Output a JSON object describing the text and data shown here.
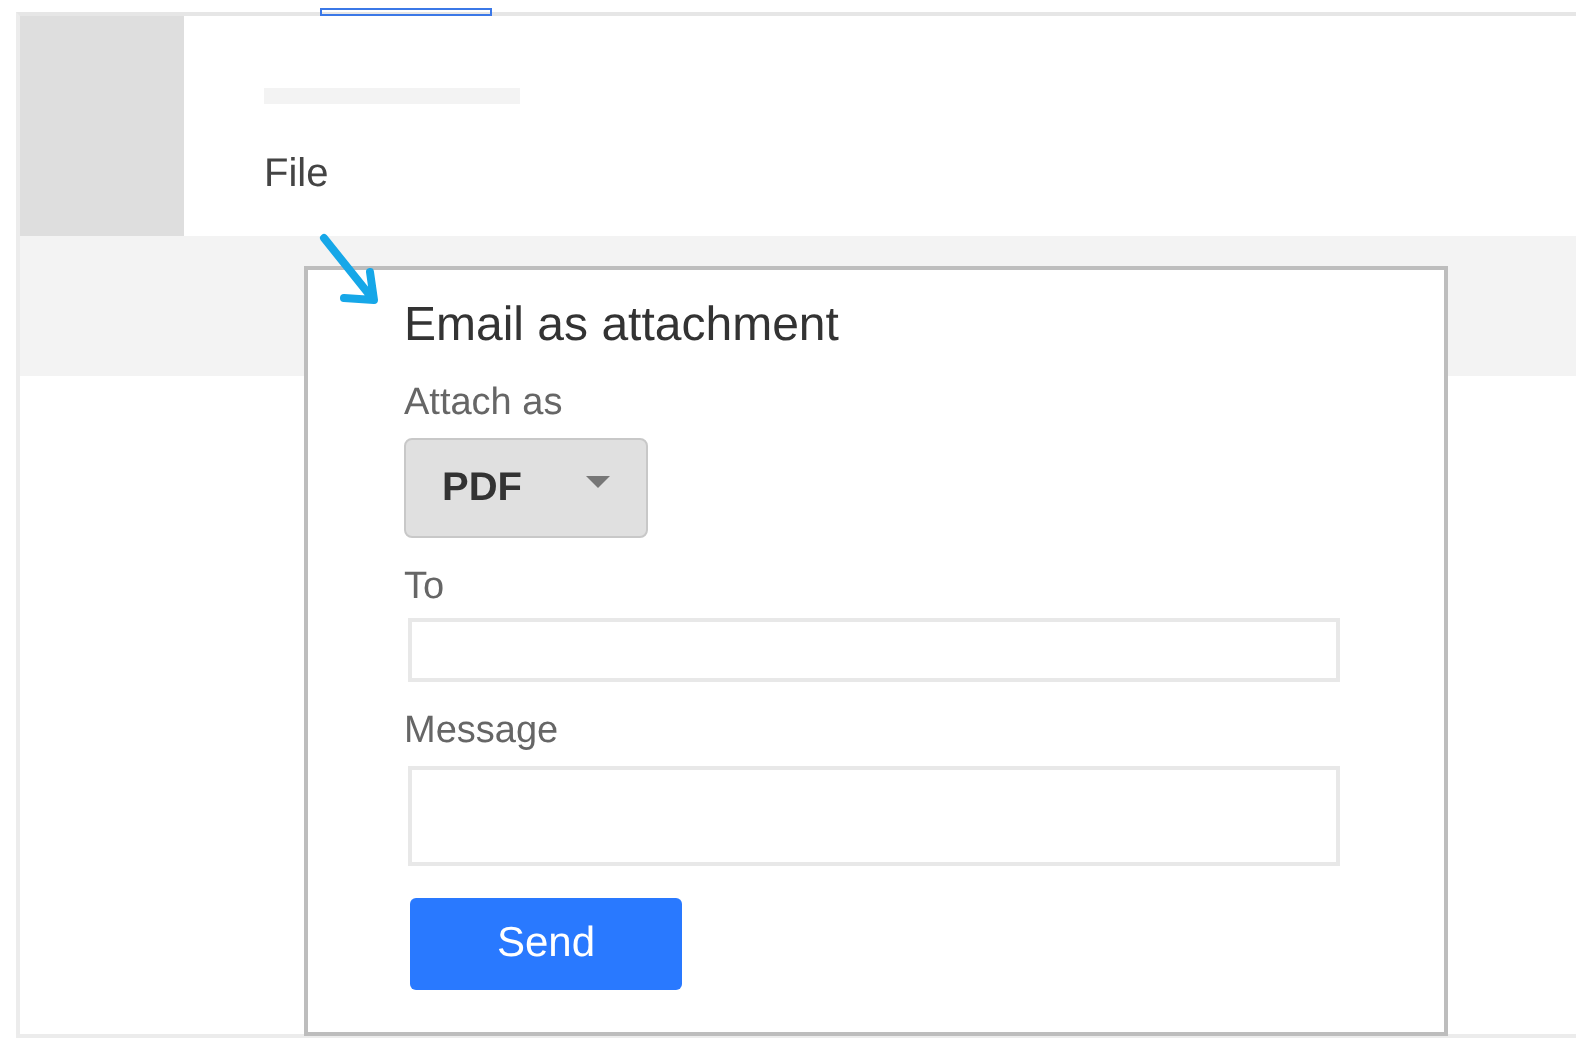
{
  "page": {
    "file_label": "File"
  },
  "dialog": {
    "title": "Email as attachment",
    "attach_label": "Attach as",
    "format": "PDF",
    "to_label": "To",
    "message_label": "Message",
    "send_button": "Send"
  }
}
